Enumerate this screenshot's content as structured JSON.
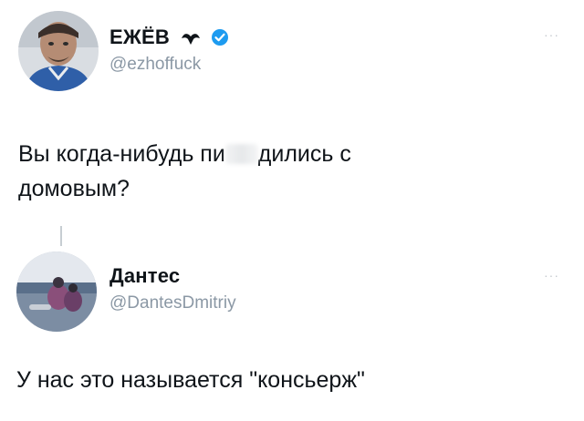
{
  "tweet1": {
    "name": "ЕЖЁВ",
    "handle": "@ezhoffuck",
    "text_before": "Вы когда-нибудь пи",
    "text_after": "дились с",
    "text_line2": "домовым?",
    "more": "···"
  },
  "tweet2": {
    "name": "Дантес",
    "handle": "@DantesDmitriy",
    "text": "У нас это называется \"консьерж\"",
    "more": "···"
  },
  "colors": {
    "verified": "#1d9bf0",
    "handle": "#8b98a5"
  }
}
